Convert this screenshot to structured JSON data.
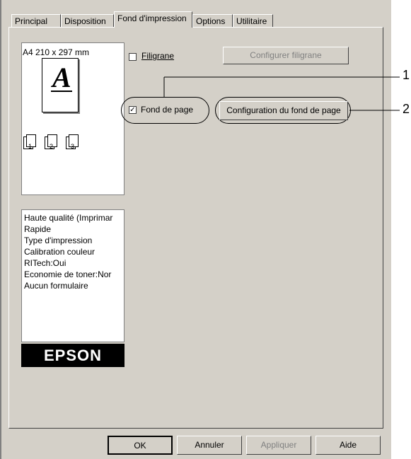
{
  "tabs": [
    "Principal",
    "Disposition",
    "Fond d'impression",
    "Options",
    "Utilitaire"
  ],
  "preview": {
    "paper_size": "A4 210 x 297 mm",
    "page_letter": "A",
    "mini_pages": [
      "1",
      "2",
      "3"
    ]
  },
  "settings_list": [
    "Haute qualité (Imprimar",
    "Rapide",
    "Type d'impression",
    "Calibration couleur",
    "RITech:Oui",
    "Economie de toner:Nor",
    "Aucun formulaire"
  ],
  "brand": "EPSON",
  "watermark": {
    "checkbox_label": "Filigrane",
    "checked": false,
    "button_label": "Configurer filigrane"
  },
  "overlay": {
    "checkbox_label": "Fond de page",
    "checked": true,
    "button_label": "Configuration du fond de page"
  },
  "callouts": [
    "1",
    "2"
  ],
  "buttons": {
    "ok": "OK",
    "cancel": "Annuler",
    "apply": "Appliquer",
    "help": "Aide"
  }
}
